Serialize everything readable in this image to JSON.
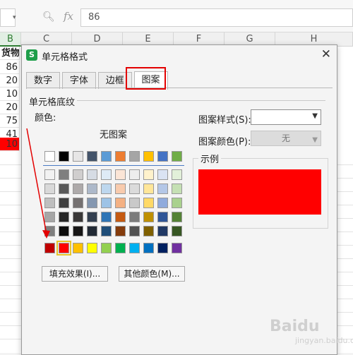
{
  "formula_bar": {
    "value": "86",
    "fx_label": "fx"
  },
  "columns": [
    "B",
    "C",
    "D",
    "E",
    "F",
    "G",
    "H"
  ],
  "active_column": "B",
  "column_cells": [
    "货物数",
    "86",
    "20",
    "10",
    "20",
    "75",
    "41",
    "10"
  ],
  "dialog": {
    "title": "单元格格式",
    "app_icon": "S",
    "close_icon": "close-icon",
    "tabs": [
      "数字",
      "字体",
      "边框",
      "图案"
    ],
    "active_tab": "图案",
    "section_title": "单元格底纹",
    "color_label": "颜色:",
    "no_pattern": "无图案",
    "fill_effect_button": "填充效果(I)...",
    "more_colors_button": "其他颜色(M)...",
    "pattern_style_label": "图案样式(S):",
    "pattern_color_label": "图案颜色(P):",
    "pattern_color_value": "无",
    "sample_label": "示例",
    "sample_color": "#ff0000",
    "selected_color": "#ff0000"
  },
  "palette": {
    "top_row": [
      "#ffffff",
      "#000000",
      "#e7e6e6",
      "#44546a",
      "#5b9bd5",
      "#ed7d31",
      "#a5a5a5",
      "#ffc000",
      "#4472c4",
      "#70ad47"
    ],
    "tint_rows": [
      [
        "#f2f2f2",
        "#7f7f7f",
        "#d0cece",
        "#d6dce4",
        "#deebf6",
        "#fbe5d6",
        "#ededed",
        "#fff2cc",
        "#dae3f3",
        "#e2f0d9"
      ],
      [
        "#d9d9d9",
        "#595959",
        "#aeaaaa",
        "#adb9ca",
        "#bdd7ee",
        "#f8cbad",
        "#dbdbdb",
        "#ffe699",
        "#b4c7e7",
        "#c5e0b4"
      ],
      [
        "#bfbfbf",
        "#404040",
        "#757171",
        "#8497b0",
        "#9dc3e6",
        "#f4b183",
        "#c9c9c9",
        "#ffd966",
        "#8faadc",
        "#a9d18e"
      ],
      [
        "#a6a6a6",
        "#262626",
        "#3a3838",
        "#333f50",
        "#2e75b6",
        "#c55a11",
        "#7b7b7b",
        "#bf9000",
        "#2f5597",
        "#548235"
      ],
      [
        "#7f7f7f",
        "#0d0d0d",
        "#171616",
        "#222a35",
        "#1f4e79",
        "#843c0c",
        "#525252",
        "#7f6000",
        "#203864",
        "#375623"
      ]
    ],
    "standard_row": [
      "#c00000",
      "#ff0000",
      "#ffc000",
      "#ffff00",
      "#92d050",
      "#00b050",
      "#00b0f0",
      "#0070c0",
      "#002060",
      "#7030a0"
    ]
  },
  "watermark": {
    "text": "Baidu",
    "sub": "jingyan.baidu.com"
  },
  "annotation_color": "#e30000"
}
